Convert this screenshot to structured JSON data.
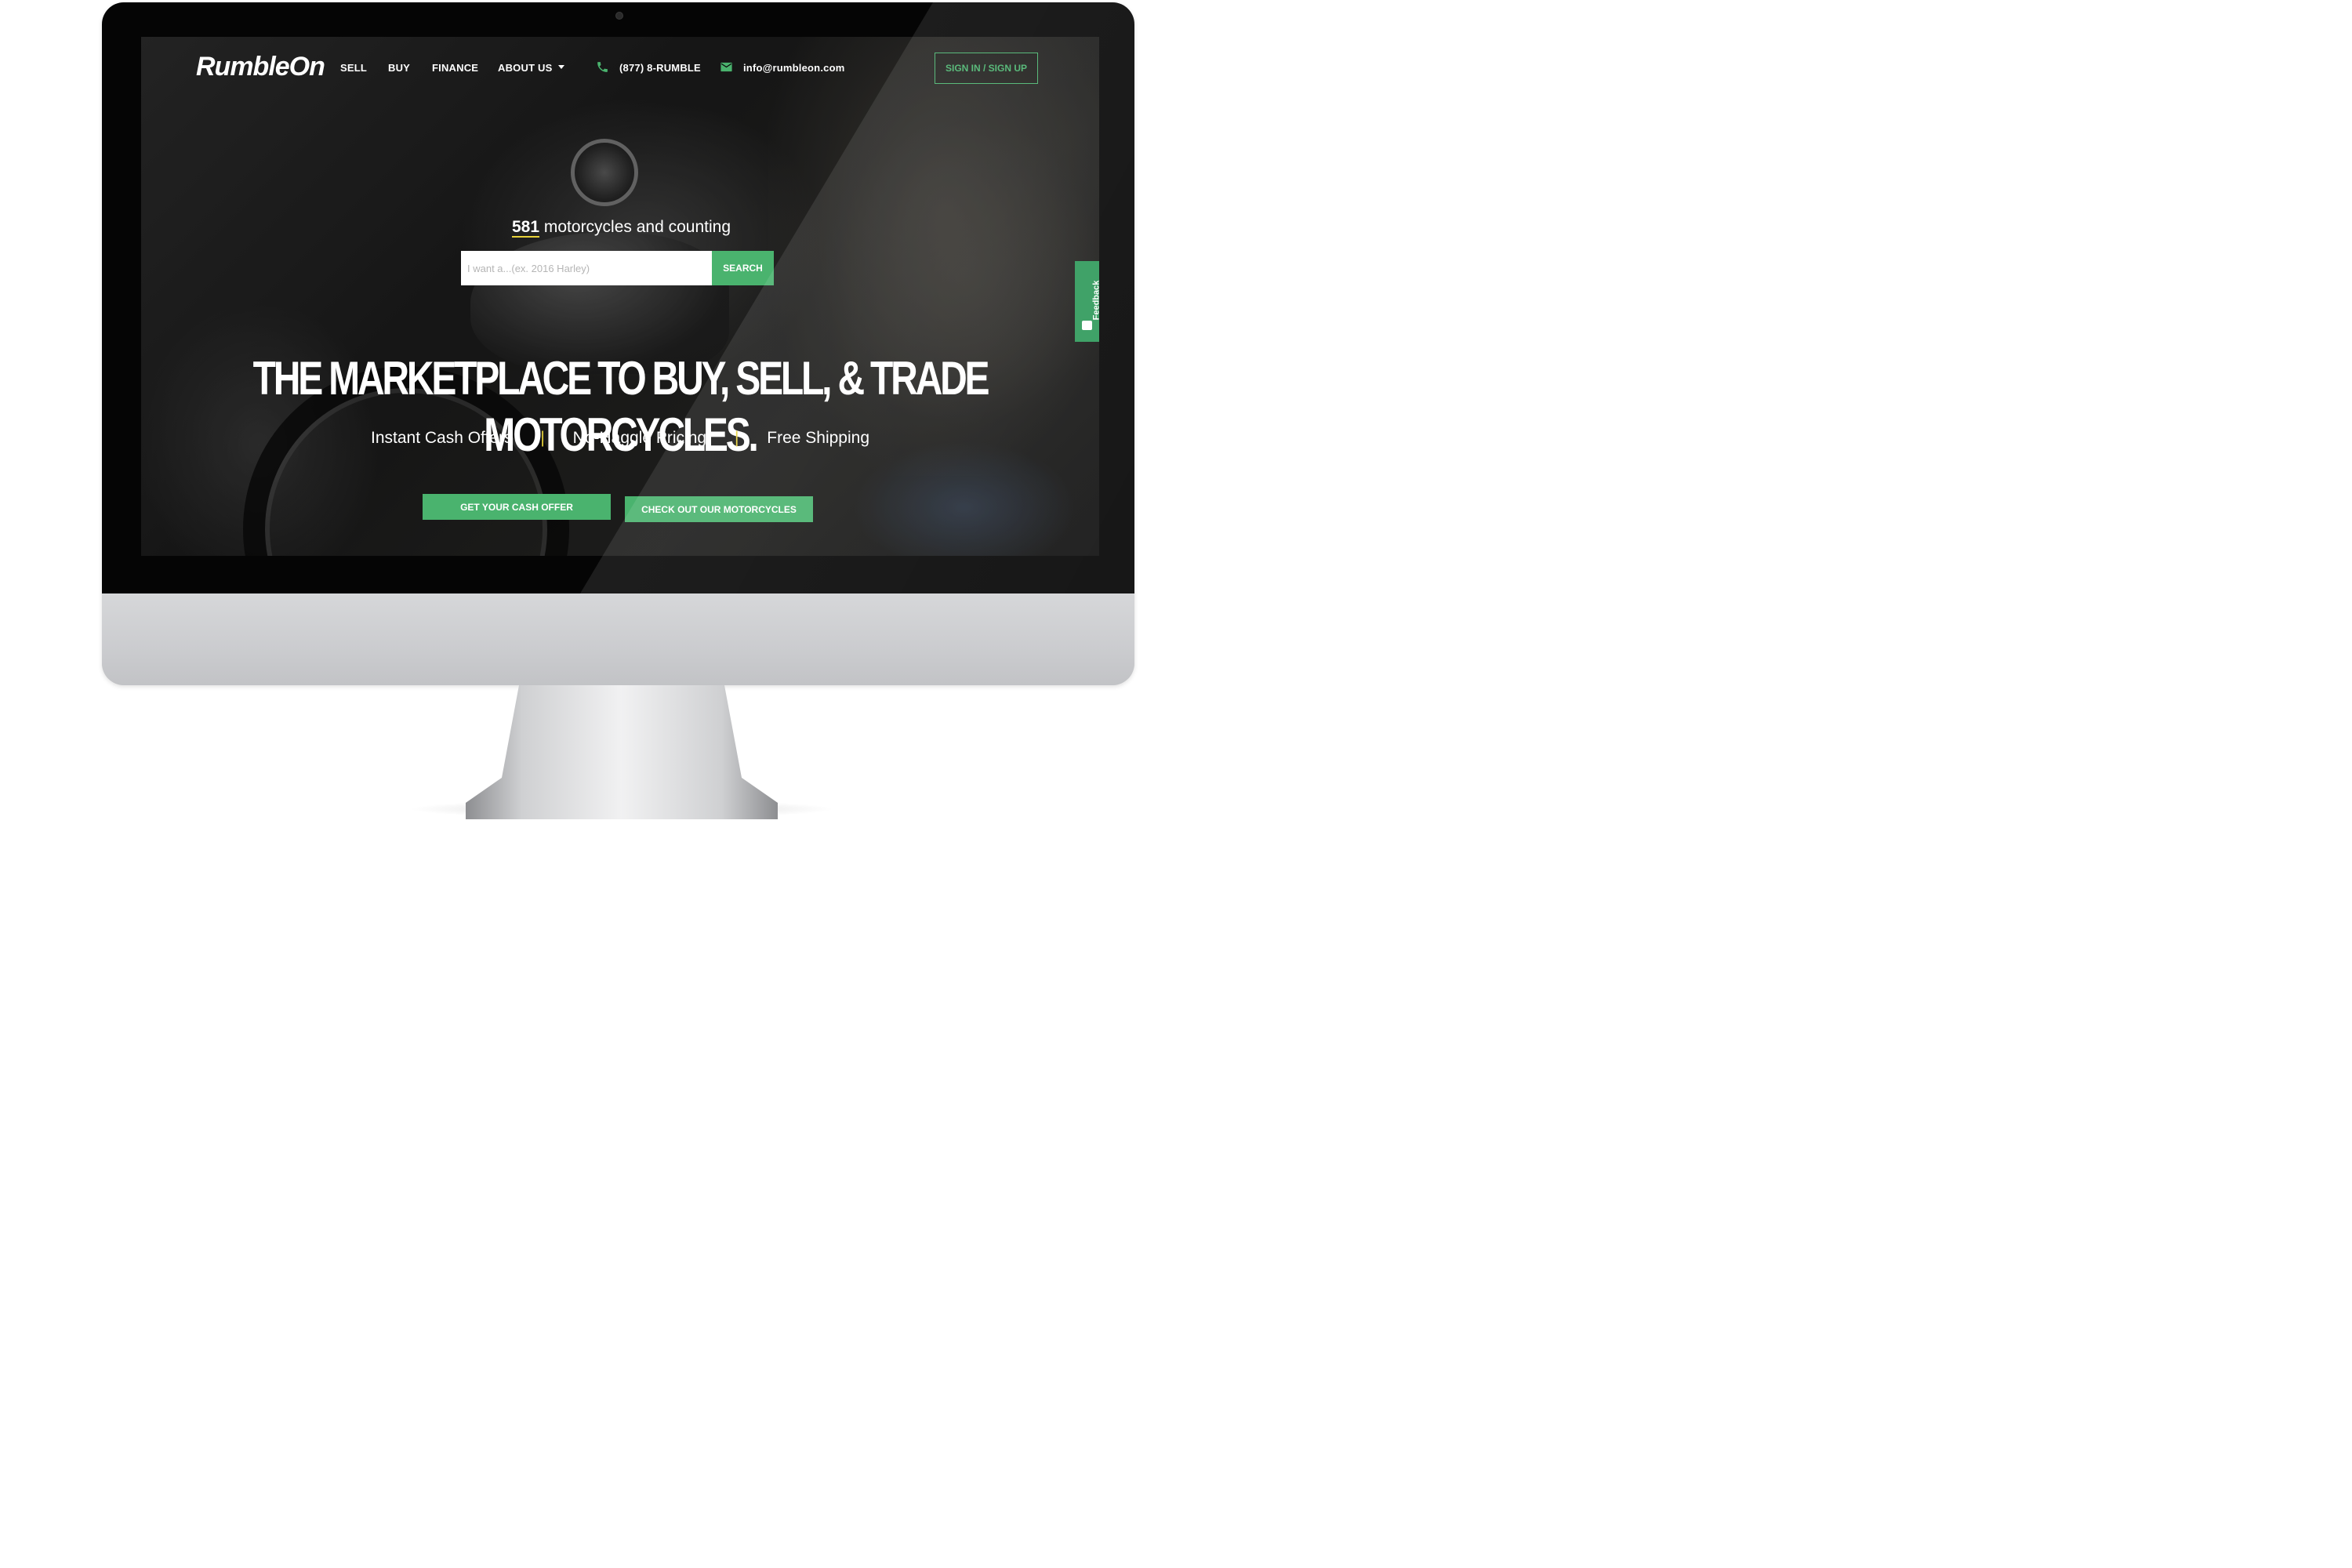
{
  "nav": {
    "logo": "RumbleOn",
    "sell": "SELL",
    "buy": "BUY",
    "finance": "FINANCE",
    "about": "ABOUT US",
    "phone": "(877) 8-RUMBLE",
    "email": "info@rumbleon.com",
    "signin": "SIGN IN / SIGN UP",
    "icons": {
      "phone": "phone-icon",
      "email": "mail-icon",
      "about_dropdown": "chevron-down-icon"
    }
  },
  "hero": {
    "count": "581",
    "count_suffix": " motorcycles and counting",
    "search_placeholder": "I want a...(ex. 2016 Harley)",
    "search_button": "SEARCH",
    "headline": "THE MARKETPLACE TO BUY, SELL, & TRADE MOTORCYCLES.",
    "features": [
      "Instant Cash Offers",
      "No-Haggle Pricing",
      "Free Shipping"
    ],
    "separator": "|",
    "cta_cash": "GET YOUR CASH OFFER",
    "cta_motorcycles": "CHECK OUT OUR MOTORCYCLES"
  },
  "feedback": {
    "label": "Feedback",
    "icon": "feedback-icon"
  },
  "colors": {
    "accent": "#4ab36e",
    "highlight": "#e8d23a",
    "bezel": "#050505"
  }
}
